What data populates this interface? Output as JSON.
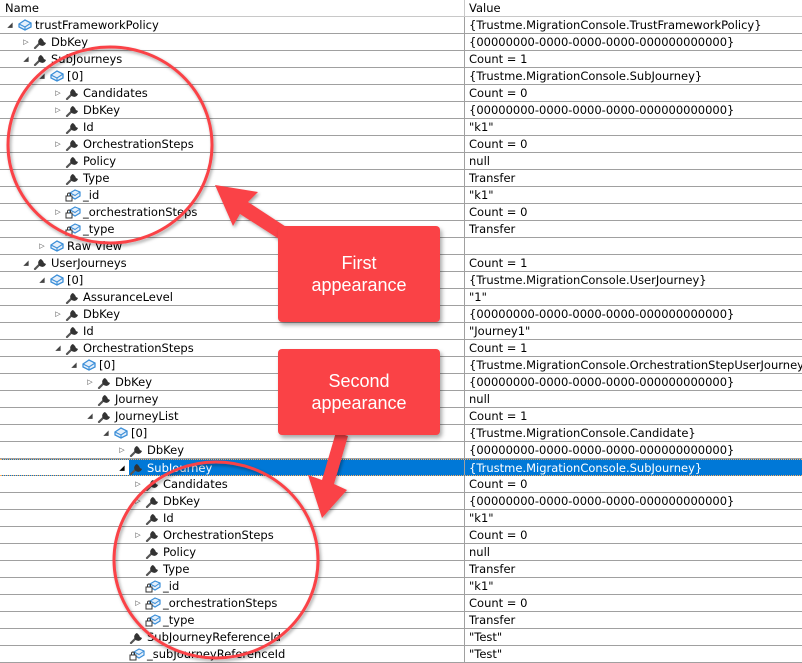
{
  "columns": {
    "name": "Name",
    "value": "Value"
  },
  "rows": [
    {
      "level": 0,
      "expand": "open",
      "icon": "object-icon",
      "name": "trustFrameworkPolicy",
      "value": "{Trustme.MigrationConsole.TrustFrameworkPolicy}"
    },
    {
      "level": 1,
      "expand": "closed",
      "icon": "property-icon",
      "name": "DbKey",
      "value": "{00000000-0000-0000-0000-000000000000}"
    },
    {
      "level": 1,
      "expand": "open",
      "icon": "property-icon",
      "name": "SubJourneys",
      "value": "Count = 1"
    },
    {
      "level": 2,
      "expand": "open",
      "icon": "object-icon",
      "name": "[0]",
      "value": "{Trustme.MigrationConsole.SubJourney}"
    },
    {
      "level": 3,
      "expand": "closed",
      "icon": "property-icon",
      "name": "Candidates",
      "value": "Count = 0"
    },
    {
      "level": 3,
      "expand": "closed",
      "icon": "property-icon",
      "name": "DbKey",
      "value": "{00000000-0000-0000-0000-000000000000}"
    },
    {
      "level": 3,
      "expand": "none",
      "icon": "property-icon",
      "name": "Id",
      "value": "\"k1\""
    },
    {
      "level": 3,
      "expand": "closed",
      "icon": "property-icon",
      "name": "OrchestrationSteps",
      "value": "Count = 0"
    },
    {
      "level": 3,
      "expand": "none",
      "icon": "property-icon",
      "name": "Policy",
      "value": "null"
    },
    {
      "level": 3,
      "expand": "none",
      "icon": "property-icon",
      "name": "Type",
      "value": "Transfer"
    },
    {
      "level": 3,
      "expand": "none",
      "icon": "private-field-icon",
      "name": "_id",
      "value": "\"k1\""
    },
    {
      "level": 3,
      "expand": "closed",
      "icon": "private-field-icon",
      "name": "_orchestrationSteps",
      "value": "Count = 0"
    },
    {
      "level": 3,
      "expand": "none",
      "icon": "private-field-icon",
      "name": "_type",
      "value": "Transfer"
    },
    {
      "level": 2,
      "expand": "closed",
      "icon": "object-icon",
      "name": "Raw View",
      "value": ""
    },
    {
      "level": 1,
      "expand": "open",
      "icon": "property-icon",
      "name": "UserJourneys",
      "value": "Count = 1"
    },
    {
      "level": 2,
      "expand": "open",
      "icon": "object-icon",
      "name": "[0]",
      "value": "{Trustme.MigrationConsole.UserJourney}"
    },
    {
      "level": 3,
      "expand": "none",
      "icon": "property-icon",
      "name": "AssuranceLevel",
      "value": "\"1\""
    },
    {
      "level": 3,
      "expand": "closed",
      "icon": "property-icon",
      "name": "DbKey",
      "value": "{00000000-0000-0000-0000-000000000000}"
    },
    {
      "level": 3,
      "expand": "none",
      "icon": "property-icon",
      "name": "Id",
      "value": "\"Journey1\""
    },
    {
      "level": 3,
      "expand": "open",
      "icon": "property-icon",
      "name": "OrchestrationSteps",
      "value": "Count = 1"
    },
    {
      "level": 4,
      "expand": "open",
      "icon": "object-icon",
      "name": "[0]",
      "value": "{Trustme.MigrationConsole.OrchestrationStepUserJourney}"
    },
    {
      "level": 5,
      "expand": "closed",
      "icon": "property-icon",
      "name": "DbKey",
      "value": "{00000000-0000-0000-0000-000000000000}"
    },
    {
      "level": 5,
      "expand": "none",
      "icon": "property-icon",
      "name": "Journey",
      "value": "null"
    },
    {
      "level": 5,
      "expand": "open",
      "icon": "property-icon",
      "name": "JourneyList",
      "value": "Count = 1"
    },
    {
      "level": 6,
      "expand": "open",
      "icon": "object-icon",
      "name": "[0]",
      "value": "{Trustme.MigrationConsole.Candidate}"
    },
    {
      "level": 7,
      "expand": "closed",
      "icon": "property-icon",
      "name": "DbKey",
      "value": "{00000000-0000-0000-0000-000000000000}"
    },
    {
      "level": 7,
      "expand": "open",
      "icon": "property-icon",
      "name": "SubJourney",
      "value": "{Trustme.MigrationConsole.SubJourney}",
      "selected": true
    },
    {
      "level": 8,
      "expand": "closed",
      "icon": "property-icon",
      "name": "Candidates",
      "value": "Count = 0"
    },
    {
      "level": 8,
      "expand": "closed",
      "icon": "property-icon",
      "name": "DbKey",
      "value": "{00000000-0000-0000-0000-000000000000}"
    },
    {
      "level": 8,
      "expand": "none",
      "icon": "property-icon",
      "name": "Id",
      "value": "\"k1\""
    },
    {
      "level": 8,
      "expand": "closed",
      "icon": "property-icon",
      "name": "OrchestrationSteps",
      "value": "Count = 0"
    },
    {
      "level": 8,
      "expand": "none",
      "icon": "property-icon",
      "name": "Policy",
      "value": "null"
    },
    {
      "level": 8,
      "expand": "none",
      "icon": "property-icon",
      "name": "Type",
      "value": "Transfer"
    },
    {
      "level": 8,
      "expand": "none",
      "icon": "private-field-icon",
      "name": "_id",
      "value": "\"k1\""
    },
    {
      "level": 8,
      "expand": "closed",
      "icon": "private-field-icon",
      "name": "_orchestrationSteps",
      "value": "Count = 0"
    },
    {
      "level": 8,
      "expand": "none",
      "icon": "private-field-icon",
      "name": "_type",
      "value": "Transfer"
    },
    {
      "level": 7,
      "expand": "none",
      "icon": "property-icon",
      "name": "SubJourneyReferenceId",
      "value": "\"Test\""
    },
    {
      "level": 7,
      "expand": "none",
      "icon": "private-field-icon",
      "name": "_subJourneyReferenceId",
      "value": "\"Test\""
    }
  ],
  "annotations": {
    "first": "First appearance",
    "first_line1": "First",
    "first_line2": "appearance",
    "second_line1": "Second",
    "second_line2": "appearance",
    "color": "#fa4246"
  },
  "colors": {
    "selection": "#0078d7",
    "object_icon": "#3c8fd8"
  }
}
